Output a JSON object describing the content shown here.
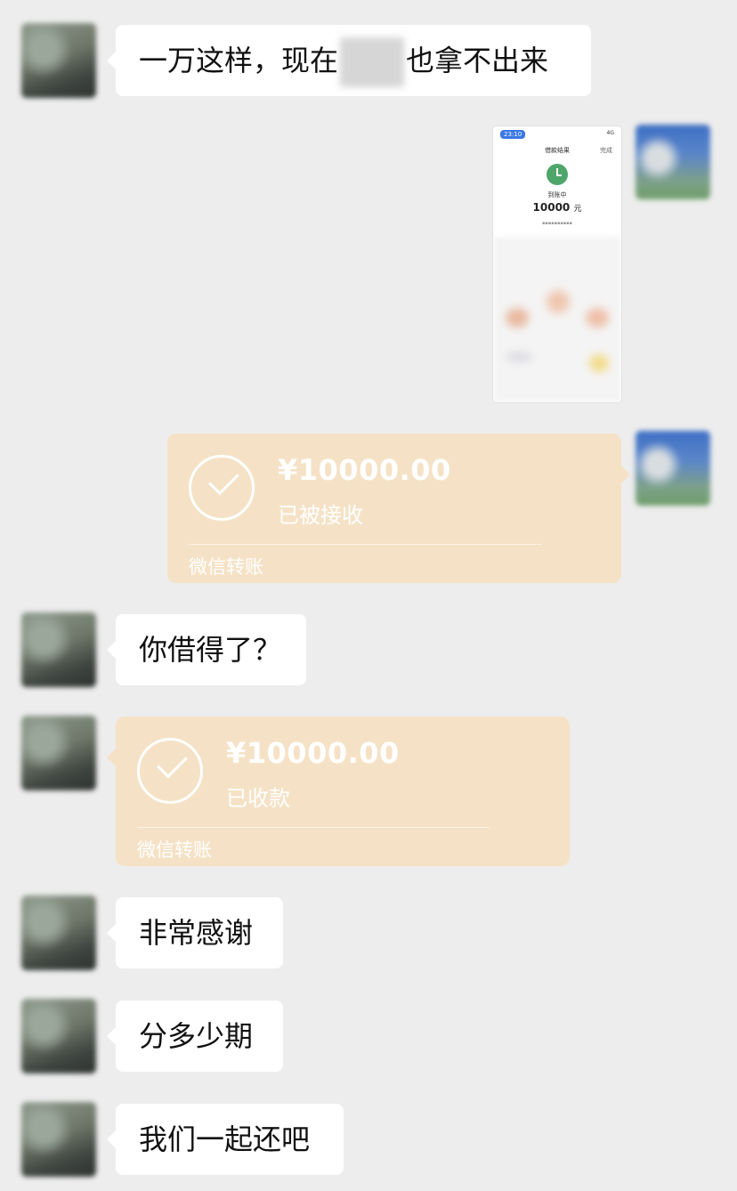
{
  "messages": {
    "m1": {
      "text_before": "一万这样，现在",
      "text_after": "也拿不出来"
    },
    "m4": {
      "text": "你借得了？"
    },
    "m6": {
      "text": "非常感谢"
    },
    "m7": {
      "text": "分多少期"
    },
    "m8": {
      "text": "我们一起还吧"
    }
  },
  "transfer_sent": {
    "amount": "¥10000.00",
    "status": "已被接收",
    "label": "微信转账"
  },
  "transfer_received": {
    "amount": "¥10000.00",
    "status": "已收款",
    "label": "微信转账"
  },
  "screenshot": {
    "time": "23:10",
    "signal": "4G",
    "title": "借款结果",
    "done": "完成",
    "state": "到账中",
    "amount": "10000",
    "currency": "元"
  },
  "colors": {
    "background": "#ededed",
    "bubble": "#ffffff",
    "transfer": "#f5e2c6",
    "success_green": "#4fa66b"
  }
}
